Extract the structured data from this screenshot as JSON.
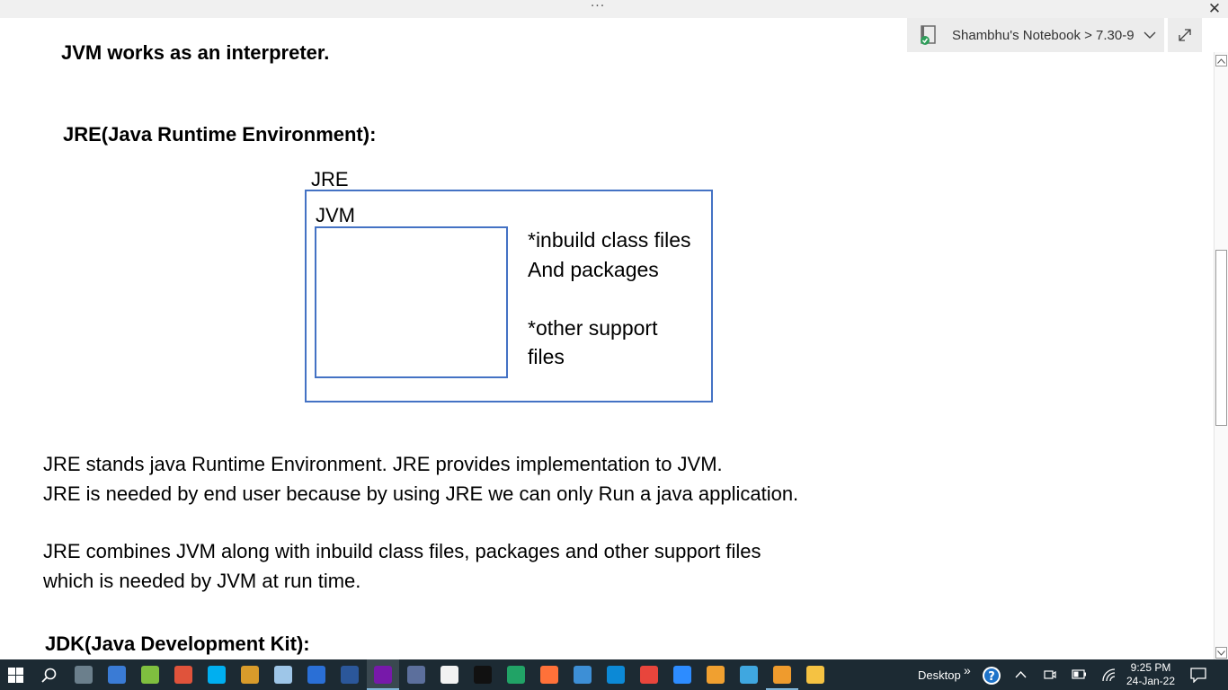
{
  "window": {
    "more_dots": "···",
    "close_glyph": "✕",
    "breadcrumb": "Shambhu's Notebook > 7.30-9"
  },
  "page": {
    "line_jvm": "JVM works as an interpreter.",
    "heading_jre": "JRE(Java Runtime Environment):",
    "diagram": {
      "outer_label": "JRE",
      "inner_label": "JVM",
      "right_lines": [
        "*inbuild class files",
        "And packages",
        "*other support",
        "files"
      ]
    },
    "para1": [
      "JRE stands java Runtime Environment. JRE provides implementation to JVM.",
      "JRE is needed by end user because by using JRE we can only Run a java application."
    ],
    "para2": [
      "JRE combines JVM along with inbuild class files, packages and other support files",
      "which is needed by JVM at run time."
    ],
    "heading_jdk": "JDK(Java Development Kit):"
  },
  "taskbar": {
    "desktop_label": "Desktop",
    "chevron": "»",
    "time": "9:25 PM",
    "date": "24-Jan-22",
    "apps": [
      {
        "name": "calculator-icon",
        "color": "#6b7f8c"
      },
      {
        "name": "keyboard-icon",
        "color": "#3a7bd5"
      },
      {
        "name": "notepad-icon",
        "color": "#7fbf3f"
      },
      {
        "name": "snip-tool-icon",
        "color": "#e0533b"
      },
      {
        "name": "skype-icon",
        "color": "#00aff0"
      },
      {
        "name": "wordpad-icon",
        "color": "#d89b2b"
      },
      {
        "name": "notes-icon",
        "color": "#9ec6e8"
      },
      {
        "name": "store-icon",
        "color": "#2a6fd6"
      },
      {
        "name": "word-icon",
        "color": "#2b579a"
      },
      {
        "name": "onenote-icon",
        "color": "#7719aa"
      },
      {
        "name": "app-bar-icon",
        "color": "#5c6f9c"
      },
      {
        "name": "paint-icon",
        "color": "#f2f2f2"
      },
      {
        "name": "pycharm-icon",
        "color": "#111111"
      },
      {
        "name": "refresh-app-icon",
        "color": "#21a366"
      },
      {
        "name": "firefox-icon",
        "color": "#ff7139"
      },
      {
        "name": "monitor-icon",
        "color": "#3d8fd6"
      },
      {
        "name": "edge-icon",
        "color": "#0c89d6"
      },
      {
        "name": "chrome-icon",
        "color": "#e8453c"
      },
      {
        "name": "zoom-icon",
        "color": "#2d8cff"
      },
      {
        "name": "orange-app-icon",
        "color": "#f0a030"
      },
      {
        "name": "snowflake-icon",
        "color": "#3fa7e0"
      },
      {
        "name": "w-app-icon",
        "color": "#ef9b2d"
      },
      {
        "name": "file-explorer-icon",
        "color": "#f5c242"
      }
    ]
  }
}
